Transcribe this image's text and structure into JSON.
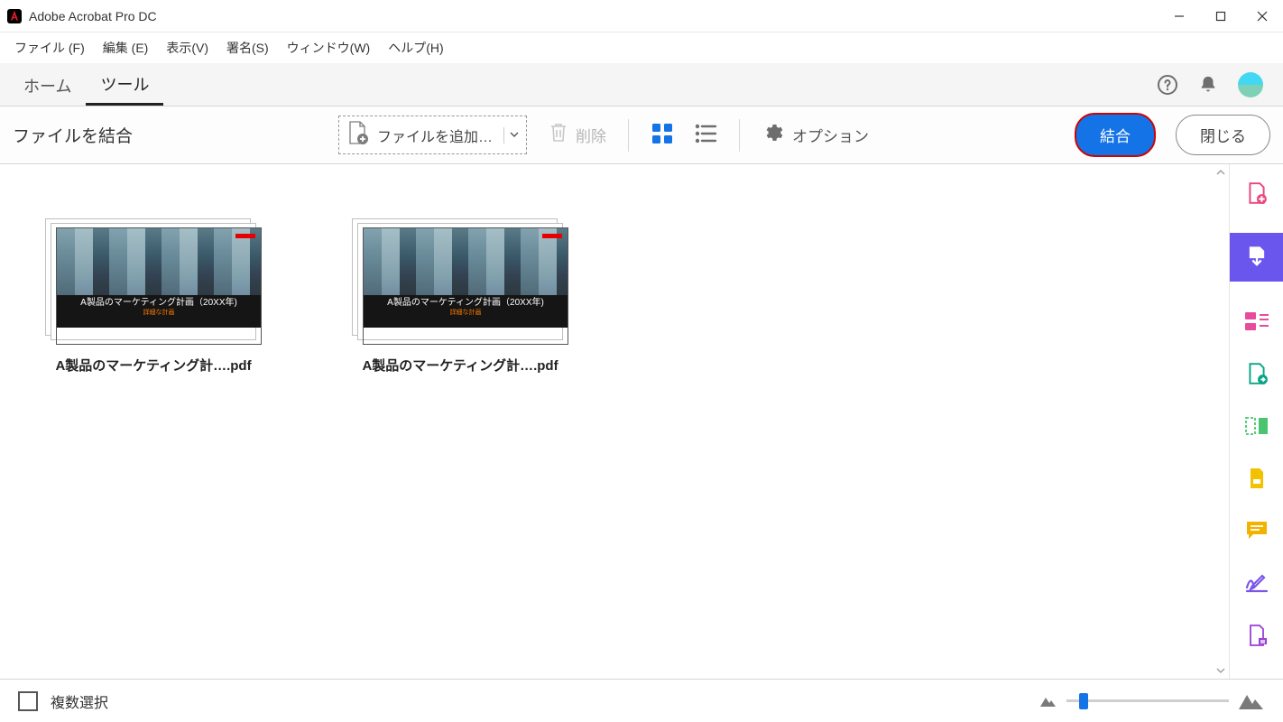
{
  "app_title": "Adobe Acrobat Pro DC",
  "menu": {
    "file": "ファイル (F)",
    "edit": "編集 (E)",
    "view": "表示(V)",
    "sign": "署名(S)",
    "window": "ウィンドウ(W)",
    "help": "ヘルプ(H)"
  },
  "tabs": {
    "home": "ホーム",
    "tools": "ツール"
  },
  "toolbar": {
    "title": "ファイルを結合",
    "add_files": "ファイルを追加…",
    "delete": "削除",
    "options": "オプション",
    "combine": "結合",
    "close": "閉じる"
  },
  "files": [
    {
      "name": "A製品のマーケティング計….pdf",
      "inner_title": "A製品のマーケティング計画（20XX年)",
      "inner_sub": "詳細な計画"
    },
    {
      "name": "A製品のマーケティング計….pdf",
      "inner_title": "A製品のマーケティング計画（20XX年)",
      "inner_sub": "詳細な計画"
    }
  ],
  "footer": {
    "multiselect": "複数選択"
  }
}
